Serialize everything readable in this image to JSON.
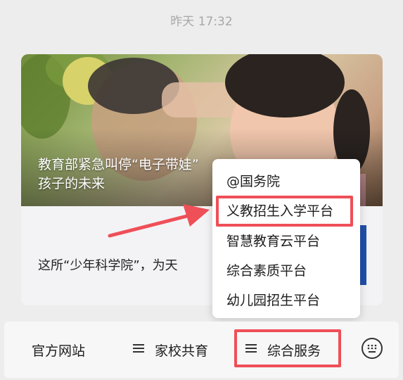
{
  "timestamp": "昨天 17:32",
  "card": {
    "headline_line1": "教育部紧急叫停“电子带娃”",
    "headline_line2": "孩子的未来",
    "article_title": "这所“少年科学院”，为天"
  },
  "popup_menu": {
    "items": [
      "@国务院",
      "义教招生入学平台",
      "智慧教育云平台",
      "综合素质平台",
      "幼儿园招生平台"
    ]
  },
  "bottom_menu": {
    "official_site": "官方网站",
    "home_school": "家校共育",
    "services": "综合服务"
  },
  "colors": {
    "highlight": "#ef4f57",
    "background": "#ededed"
  },
  "icons": [
    "hamburger-icon",
    "keyboard-icon",
    "arrow-annotation"
  ]
}
